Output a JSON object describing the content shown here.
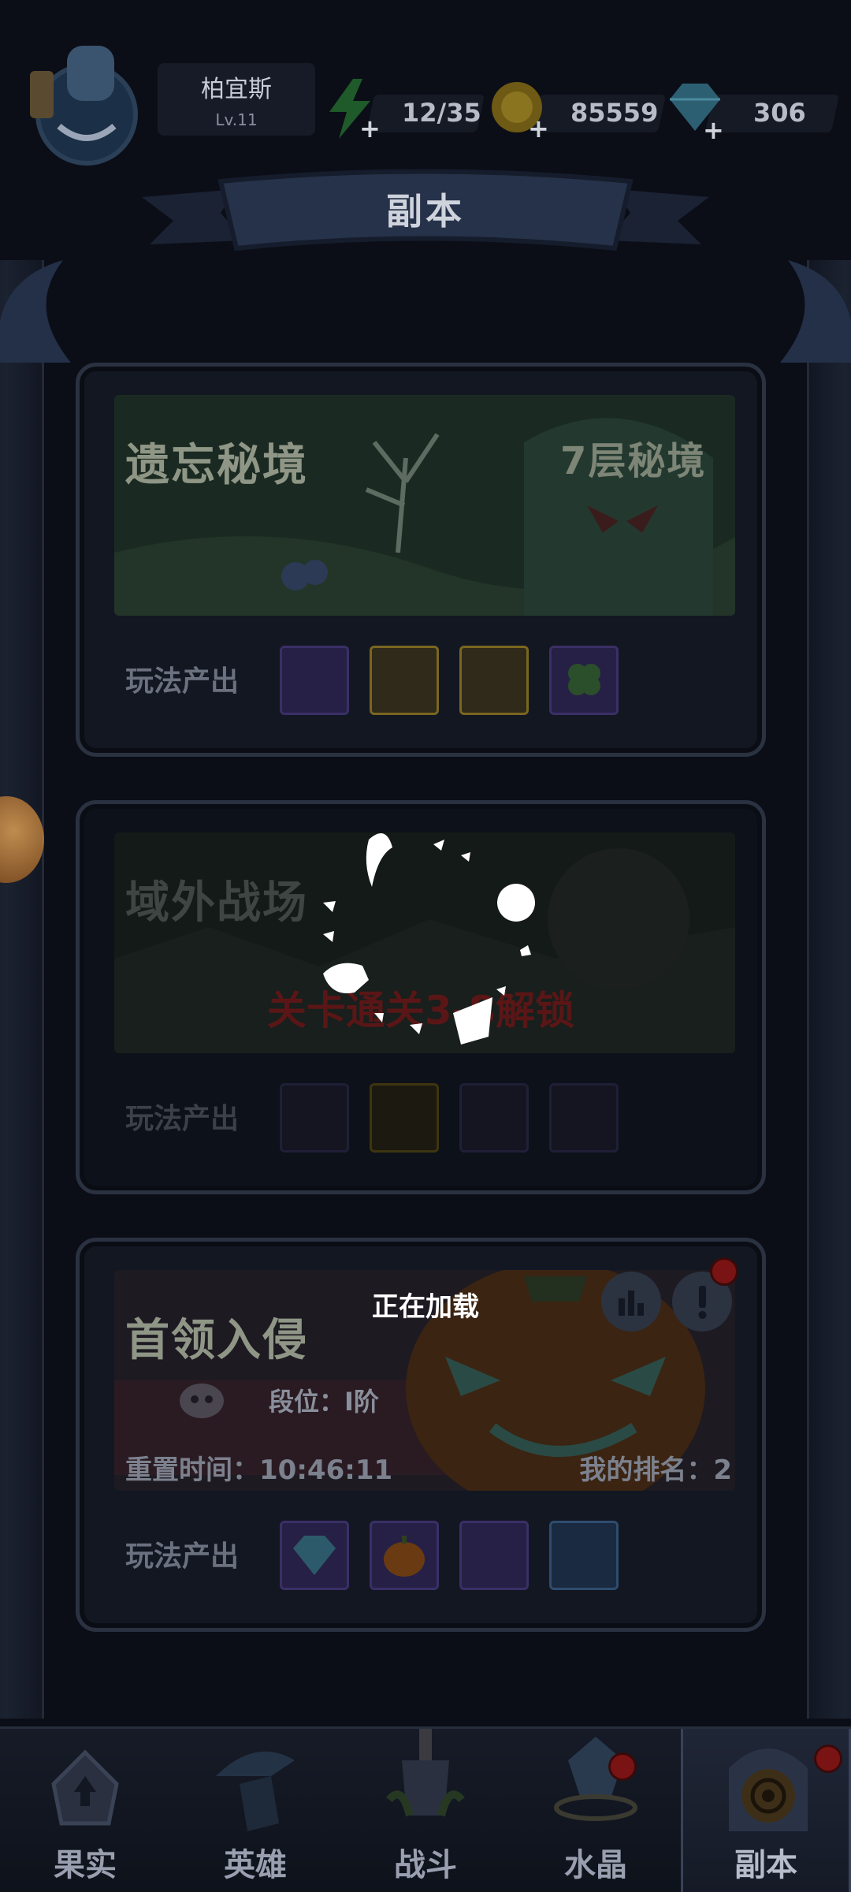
{
  "player": {
    "name": "柏宜斯",
    "level": "Lv.11"
  },
  "resources": {
    "energy": {
      "value": "12/35",
      "icon": "lightning-icon"
    },
    "gold": {
      "value": "85559",
      "icon": "coin-icon"
    },
    "diamond": {
      "value": "306",
      "icon": "diamond-icon"
    }
  },
  "page_title": "副本",
  "cards": [
    {
      "title": "遗忘秘境",
      "subtitle": "7层秘境",
      "output_label": "玩法产出",
      "rewards": [
        "mystery-chest-icon",
        "mystery-chest-icon",
        "rune-scroll-icon",
        "clover-icon"
      ]
    },
    {
      "title": "域外战场",
      "lock_text": "关卡通关3-8解锁",
      "output_label": "玩法产出",
      "rewards": [
        "diamond-icon",
        "leaf-icon",
        "mystery-chest-icon",
        "mystery-chest-icon"
      ]
    },
    {
      "title": "首领入侵",
      "rank_label": "段位：",
      "rank_value": "I阶",
      "reset_label": "重置时间：",
      "reset_time": "10:46:11",
      "my_rank_label": "我的排名：",
      "my_rank_value": "2",
      "output_label": "玩法产出",
      "rewards": [
        "diamond-icon",
        "pumpkin-icon",
        "mystery-chest-icon",
        "mystery-chest-icon"
      ]
    }
  ],
  "loading_text": "正在加载",
  "nav": [
    {
      "label": "果实",
      "icon": "fruit-icon"
    },
    {
      "label": "英雄",
      "icon": "hero-icon"
    },
    {
      "label": "战斗",
      "icon": "battle-icon"
    },
    {
      "label": "水晶",
      "icon": "crystal-icon"
    },
    {
      "label": "副本",
      "icon": "dungeon-icon",
      "active": true
    }
  ]
}
